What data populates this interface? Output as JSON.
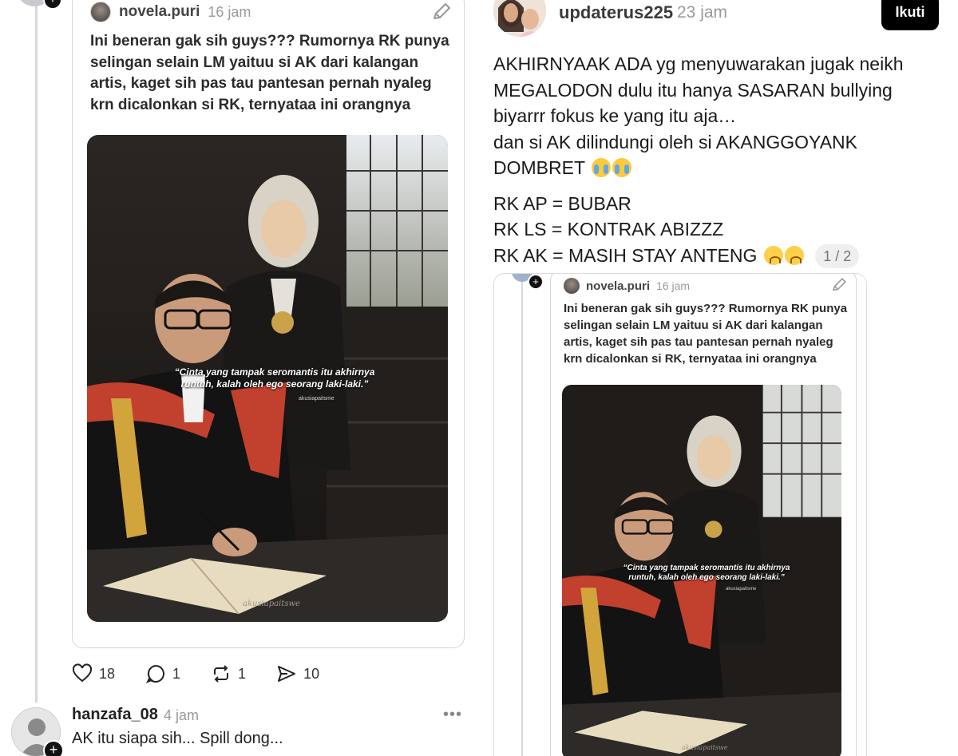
{
  "left_thread": {
    "quoted_post": {
      "username": "novela.puri",
      "time": "16 jam",
      "text": "Ini beneran gak sih guys??? Rumornya RK punya selingan selain LM yaituu si AK dari kalangan artis, kaget sih pas tau pantesan pernah nyaleg krn dicalonkan si RK, ternyataa ini orangnya",
      "photo_caption": "“Cinta yang tampak seromantis itu akhirnya runtuh, kalah oleh ego seorang laki-laki.”",
      "photo_handle": "akusiapaitsme",
      "photo_signature": "akusiapaitswe"
    },
    "actions": {
      "likes": "18",
      "comments": "1",
      "reposts": "1",
      "shares": "10"
    },
    "reply": {
      "username": "hanzafa_08",
      "time": "4 jam",
      "text": "AK itu siapa sih... Spill dong...",
      "more": "•••"
    }
  },
  "right_post": {
    "username": "updaterus225",
    "time": "23 jam",
    "follow_label": "Ikuti",
    "lines": [
      "AKHIRNYAAK ADA yg menyuwarakan jugak neikh",
      "MEGALODON dulu itu hanya SASARAN bullying",
      "biyarrr fokus ke yang itu aja…",
      "dan si AK dilindungi oleh si AKANGGOYANK",
      "DOMBRET"
    ],
    "lines2": [
      "RK AP = BUBAR",
      "RK LS = KONTRAK ABIZZZ",
      "RK AK = MASIH STAY ANTENG"
    ],
    "page_indicator": "1 / 2",
    "embedded_quote": {
      "username": "novela.puri",
      "time": "16 jam",
      "text": "Ini beneran gak sih guys??? Rumornya RK punya selingan selain LM yaituu si AK dari kalangan artis, kaget sih pas tau pantesan pernah nyaleg krn dicalonkan si RK, ternyataa ini orangnya",
      "photo_caption": "“Cinta yang tampak seromantis itu akhirnya runtuh, kalah oleh ego seorang laki-laki.”",
      "photo_handle": "akusiapaitsme",
      "photo_signature": "akusiapaitswe"
    }
  },
  "colors": {
    "accent_black": "#000000",
    "muted_text": "#9a9a9a",
    "border": "#d6d6d6"
  }
}
